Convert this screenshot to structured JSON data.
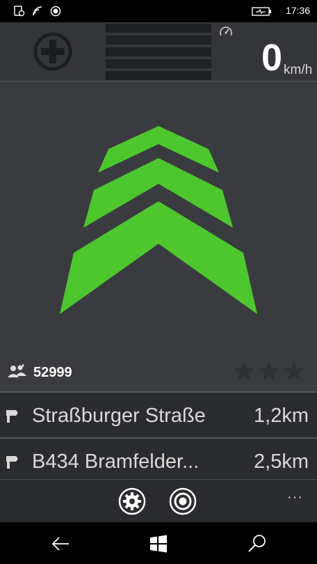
{
  "status_bar": {
    "time": "17:36",
    "icons": [
      "data-sync-icon",
      "wifi-icon",
      "location-icon",
      "battery-charging-icon"
    ]
  },
  "top_bar": {
    "add_button_icon": "plus-circle-icon",
    "speedometer_icon": "speedometer-icon",
    "speed_value": "0",
    "speed_unit": "km/h"
  },
  "main": {
    "direction_icon": "chevron-up-icon",
    "user_count_icon": "users-icon",
    "user_count": "52999",
    "rating_icon": "star-icon",
    "rating_stars_filled": 0,
    "rating_stars_total": 3,
    "accent_color": "#4ec72f"
  },
  "route_list": {
    "items": [
      {
        "name": "Straßburger Straße",
        "distance": "1,2km"
      },
      {
        "name": "B434 Bramfelder...",
        "distance": "2,5km"
      }
    ]
  },
  "app_bar": {
    "buttons": [
      "settings-icon",
      "target-icon"
    ],
    "more_label": "···"
  },
  "nav_bar": {
    "buttons": [
      "back-icon",
      "windows-icon",
      "search-icon"
    ]
  }
}
